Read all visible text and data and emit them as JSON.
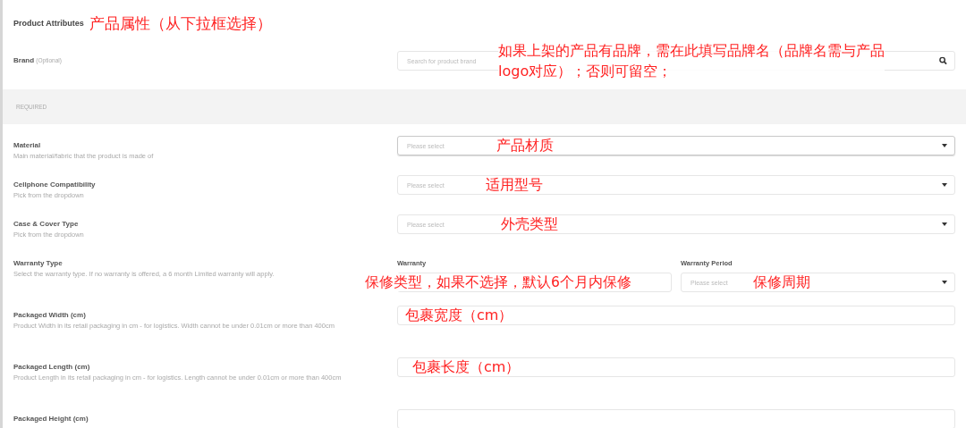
{
  "section_title": "Product Attributes",
  "title_note": "产品属性（从下拉框选择）",
  "optional_fields": [
    {
      "label": "Brand",
      "tag": "(Optional)",
      "kind": "search",
      "placeholder": "Search for product brand",
      "note_lines": [
        "如果上架的产品有品牌，需在此填写品牌名（品牌名需与产品",
        "logo对应）；否则可留空；"
      ]
    }
  ],
  "required_heading": "REQUIRED",
  "required_fields": [
    {
      "kind": "select",
      "label": "Material",
      "hint": "Main material/fabric that the product is made of",
      "placeholder": "Please select",
      "note": "产品材质",
      "focused": true
    },
    {
      "kind": "select",
      "label": "Cellphone Compatibility",
      "hint": "Pick from the dropdown",
      "placeholder": "Please select",
      "note": "适用型号",
      "focused": false
    },
    {
      "kind": "select",
      "label": "Case & Cover Type",
      "hint": "Pick from the dropdown",
      "placeholder": "Please select",
      "note": "外壳类型",
      "focused": false
    },
    {
      "kind": "pair",
      "label": "Warranty Type",
      "hint": "Select the warranty type. If no warranty is offered, a 6 month Limited warranty will apply.",
      "parts": [
        {
          "label": "Warranty",
          "note": "保修类型，如果不选择，默认6个月内保修"
        },
        {
          "label": "Warranty Period",
          "placeholder": "Please select",
          "note": "保修周期"
        }
      ]
    },
    {
      "kind": "text",
      "label": "Packaged Width (cm)",
      "hint": "Product Width in its retail packaging in cm - for logistics. Width cannot be under 0.01cm or more than 400cm",
      "note": "包裹宽度（cm）"
    },
    {
      "kind": "text",
      "label": "Packaged Length (cm)",
      "hint": "Product Length in its retail packaging in cm - for logistics. Length cannot be under 0.01cm or more than 400cm",
      "note": "包裹长度（cm）"
    },
    {
      "kind": "text",
      "label": "Packaged Height (cm)"
    }
  ]
}
